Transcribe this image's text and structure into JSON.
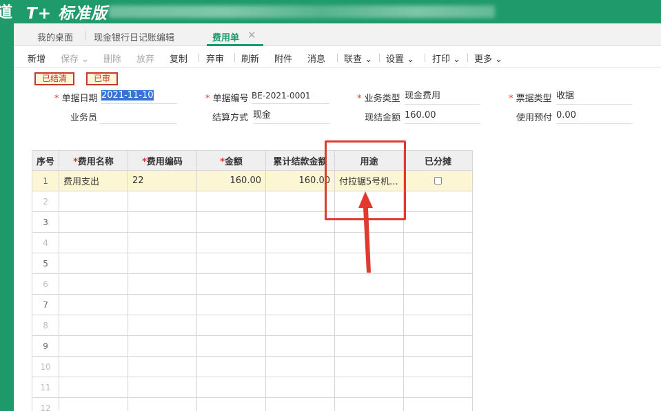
{
  "app": {
    "edge_glyph": "道",
    "logo": "T+ 标准版"
  },
  "tabs": [
    {
      "label": "我的桌面"
    },
    {
      "label": "现金银行日记账编辑"
    },
    {
      "label": "费用单",
      "active": true
    }
  ],
  "toolbar": {
    "new": "新增",
    "save": "保存",
    "delete": "删除",
    "discard": "放弃",
    "copy": "复制",
    "abandon": "弃审",
    "refresh": "刷新",
    "attach": "附件",
    "message": "消息",
    "link": "联查",
    "settings": "设置",
    "print": "打印",
    "more": "更多"
  },
  "badges": {
    "settled": "已结清",
    "audited": "已审"
  },
  "form": {
    "date_label": "单据日期",
    "date_value": "2021-11-10",
    "code_label": "单据编号",
    "code_value": "BE-2021-0001",
    "biz_type_label": "业务类型",
    "biz_type_value": "现金费用",
    "ticket_type_label": "票据类型",
    "ticket_type_value": "收据",
    "staff_label": "业务员",
    "staff_value": "",
    "settle_label": "结算方式",
    "settle_value": "现金",
    "cash_amount_label": "现结金额",
    "cash_amount_value": "160.00",
    "prepay_label": "使用预付",
    "prepay_value": "0.00"
  },
  "grid": {
    "headers": [
      "序号",
      "费用名称",
      "费用编码",
      "金额",
      "累计结款金额",
      "用途",
      "已分摊"
    ],
    "required": [
      false,
      true,
      true,
      true,
      false,
      false,
      false
    ],
    "rows": [
      [
        "1",
        "费用支出",
        "22",
        "160.00",
        "160.00",
        "付拉锯5号机..."
      ],
      [
        "2"
      ],
      [
        "3"
      ],
      [
        "4"
      ],
      [
        "5"
      ],
      [
        "6"
      ],
      [
        "7"
      ],
      [
        "8"
      ],
      [
        "9"
      ],
      [
        "10"
      ],
      [
        "11"
      ],
      [
        "12"
      ]
    ]
  },
  "colors": {
    "brand": "#1f9b6b",
    "annotation": "#e03a2e"
  }
}
